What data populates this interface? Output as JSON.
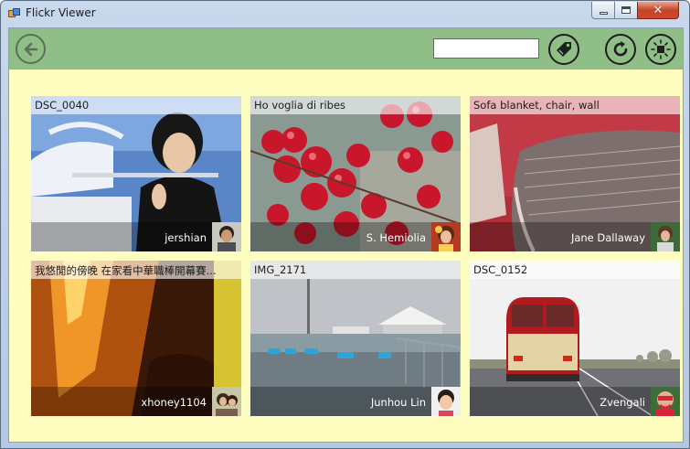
{
  "window": {
    "title": "Flickr Viewer"
  },
  "toolbar": {
    "search": {
      "value": "",
      "placeholder": ""
    },
    "icons": [
      "back-arrow-icon",
      "tag-icon",
      "refresh-icon",
      "stop-icon"
    ]
  },
  "photos": [
    {
      "title": "DSC_0040",
      "owner": "jershian"
    },
    {
      "title": "Ho voglia di ribes",
      "owner": "S. Hemiolia"
    },
    {
      "title": "Sofa blanket, chair, wall",
      "owner": "Jane Dallaway"
    },
    {
      "title": "我悠閒的傍晚  在家看中華職棒開幕賽...",
      "owner": "xhoney1104"
    },
    {
      "title": "IMG_2171",
      "owner": "Junhou Lin"
    },
    {
      "title": "DSC_0152",
      "owner": "Zvengali"
    }
  ],
  "colors": {
    "toolbar": "#8fbf87",
    "client": "#fefec0"
  }
}
